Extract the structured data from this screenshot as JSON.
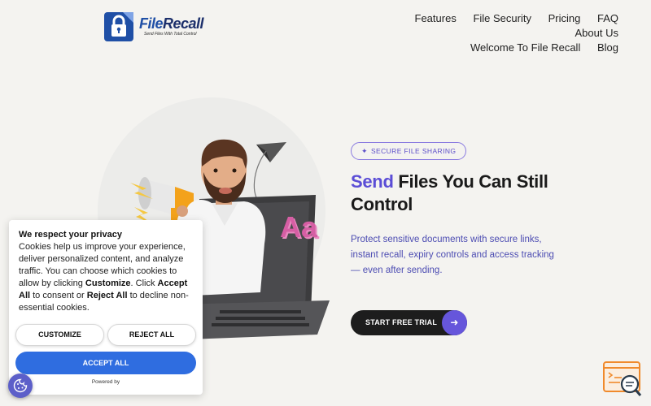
{
  "brand": {
    "name_part1": "File",
    "name_part2": "Recall",
    "tagline": "Send Files With Total Control"
  },
  "nav": {
    "items": [
      "Features",
      "File Security",
      "Pricing",
      "FAQ",
      "About Us",
      "Welcome To File Recall",
      "Blog"
    ]
  },
  "hero": {
    "badge": "SECURE FILE SHARING",
    "title_accent": "Send",
    "title_rest": " Files You Can Still Control",
    "description": "Protect sensitive documents with secure links, instant recall, expiry controls and access tracking— even after sending.",
    "cta_label": "START FREE TRIAL",
    "illustration_text": "Aa"
  },
  "cookie": {
    "title": "We respect your privacy",
    "body_1": "Cookies help us improve your experience, deliver personalized content, and analyze traffic. You can choose which cookies to allow by clicking ",
    "body_customize": "Customize",
    "body_2": ". Click ",
    "body_accept": "Accept All",
    "body_3": " to consent or ",
    "body_reject": "Reject All",
    "body_4": " to decline non-essential cookies.",
    "customize_label": "CUSTOMIZE",
    "reject_label": "REJECT ALL",
    "accept_label": "ACCEPT ALL",
    "powered_by": "Powered by"
  },
  "colors": {
    "accent": "#5b4dd6",
    "accept_button": "#2f6de0",
    "brand_blue": "#1f4fa6"
  },
  "icons": {
    "logo": "padlock-logo-icon",
    "badge": "sparkle-icon",
    "cta": "arrow-right-icon",
    "cookie_settings": "cookie-icon",
    "chat": "chat-search-icon"
  }
}
